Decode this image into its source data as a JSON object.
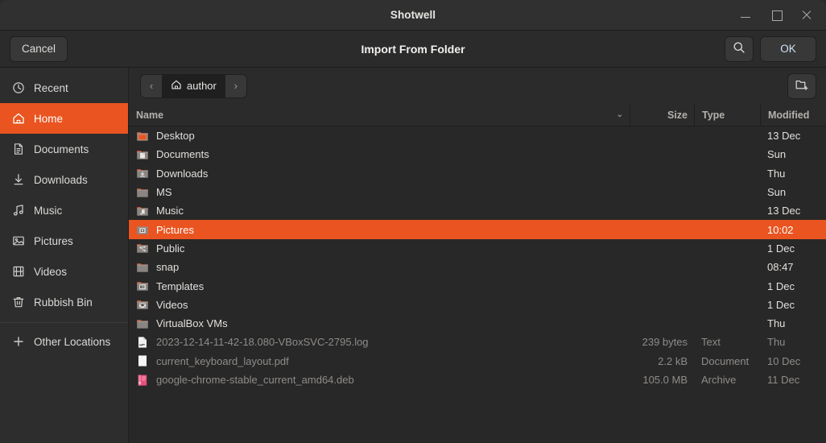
{
  "window": {
    "title": "Shotwell",
    "controls": {
      "minimize": "minimize-icon",
      "maximize": "maximize-icon",
      "close": "close-icon"
    }
  },
  "header": {
    "cancel_label": "Cancel",
    "title": "Import From Folder",
    "search_icon": "search-icon",
    "ok_label": "OK"
  },
  "pathbar": {
    "back_glyph": "‹",
    "forward_glyph": "›",
    "current_folder": "author",
    "home_icon": "home-icon",
    "new_folder_icon": "new-folder-icon"
  },
  "sidebar": {
    "items": [
      {
        "label": "Recent",
        "icon": "clock-icon",
        "active": false
      },
      {
        "label": "Home",
        "icon": "home-icon",
        "active": true
      },
      {
        "label": "Documents",
        "icon": "document-icon",
        "active": false
      },
      {
        "label": "Downloads",
        "icon": "download-icon",
        "active": false
      },
      {
        "label": "Music",
        "icon": "music-icon",
        "active": false
      },
      {
        "label": "Pictures",
        "icon": "image-icon",
        "active": false
      },
      {
        "label": "Videos",
        "icon": "video-icon",
        "active": false
      },
      {
        "label": "Rubbish Bin",
        "icon": "trash-icon",
        "active": false
      }
    ],
    "other_locations": {
      "label": "Other Locations",
      "icon": "plus-icon"
    }
  },
  "columns": {
    "name": "Name",
    "size": "Size",
    "type": "Type",
    "modified": "Modified",
    "sort_chevron": "⌄"
  },
  "files": [
    {
      "name": "Desktop",
      "size": "",
      "type": "",
      "modified": "13 Dec",
      "icon": "folder-desktop-icon",
      "kind": "folder",
      "selected": false,
      "dim": false
    },
    {
      "name": "Documents",
      "size": "",
      "type": "",
      "modified": "Sun",
      "icon": "folder-documents-icon",
      "kind": "folder",
      "selected": false,
      "dim": false
    },
    {
      "name": "Downloads",
      "size": "",
      "type": "",
      "modified": "Thu",
      "icon": "folder-downloads-icon",
      "kind": "folder",
      "selected": false,
      "dim": false
    },
    {
      "name": "MS",
      "size": "",
      "type": "",
      "modified": "Sun",
      "icon": "folder-icon",
      "kind": "folder",
      "selected": false,
      "dim": false
    },
    {
      "name": "Music",
      "size": "",
      "type": "",
      "modified": "13 Dec",
      "icon": "folder-music-icon",
      "kind": "folder",
      "selected": false,
      "dim": false
    },
    {
      "name": "Pictures",
      "size": "",
      "type": "",
      "modified": "10:02",
      "icon": "folder-pictures-icon",
      "kind": "folder",
      "selected": true,
      "dim": false
    },
    {
      "name": "Public",
      "size": "",
      "type": "",
      "modified": "1 Dec",
      "icon": "folder-public-icon",
      "kind": "folder",
      "selected": false,
      "dim": false
    },
    {
      "name": "snap",
      "size": "",
      "type": "",
      "modified": "08:47",
      "icon": "folder-icon",
      "kind": "folder",
      "selected": false,
      "dim": false
    },
    {
      "name": "Templates",
      "size": "",
      "type": "",
      "modified": "1 Dec",
      "icon": "folder-templates-icon",
      "kind": "folder",
      "selected": false,
      "dim": false
    },
    {
      "name": "Videos",
      "size": "",
      "type": "",
      "modified": "1 Dec",
      "icon": "folder-videos-icon",
      "kind": "folder",
      "selected": false,
      "dim": false
    },
    {
      "name": "VirtualBox VMs",
      "size": "",
      "type": "",
      "modified": "Thu",
      "icon": "folder-icon",
      "kind": "folder",
      "selected": false,
      "dim": false
    },
    {
      "name": "2023-12-14-11-42-18.080-VBoxSVC-2795.log",
      "size": "239 bytes",
      "type": "Text",
      "modified": "Thu",
      "icon": "text-file-icon",
      "kind": "file",
      "selected": false,
      "dim": true
    },
    {
      "name": "current_keyboard_layout.pdf",
      "size": "2.2 kB",
      "type": "Document",
      "modified": "10 Dec",
      "icon": "document-file-icon",
      "kind": "file",
      "selected": false,
      "dim": true
    },
    {
      "name": "google-chrome-stable_current_amd64.deb",
      "size": "105.0 MB",
      "type": "Archive",
      "modified": "11 Dec",
      "icon": "package-file-icon",
      "kind": "file",
      "selected": false,
      "dim": true
    }
  ],
  "colors": {
    "accent": "#e95420",
    "titlebar_bg": "#303030",
    "header_bg": "#2b2b2b",
    "sidebar_bg": "#2d2d2d",
    "list_bg": "#282828",
    "text": "#e2dfdc",
    "dim_text": "#8f8c89"
  }
}
